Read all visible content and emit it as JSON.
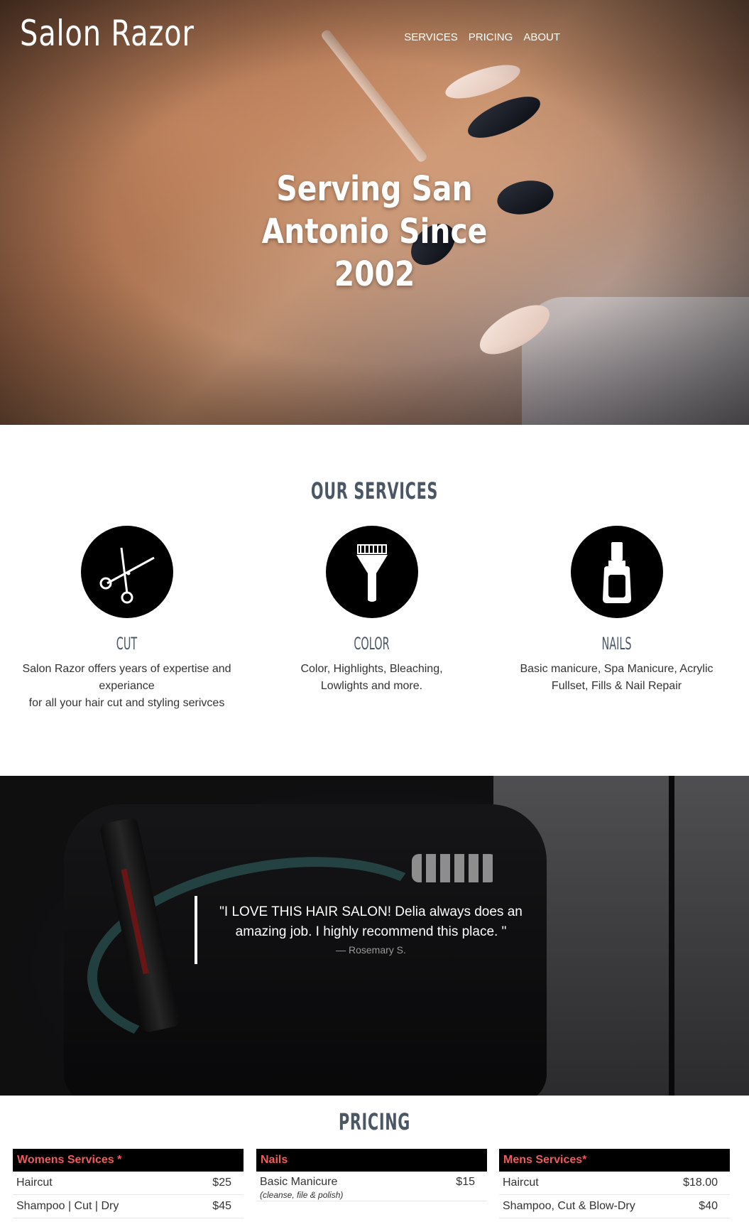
{
  "header": {
    "logo": "Salon Razor",
    "nav": [
      "SERVICES",
      "PRICING",
      "ABOUT"
    ],
    "hero_title": "Serving San Antonio Since 2002"
  },
  "services": {
    "title": "Our Services",
    "items": [
      {
        "title": "Cut",
        "icon": "scissors-icon",
        "text": "Salon Razor offers years of expertise and experiance\nfor all your hair cut and styling serivces"
      },
      {
        "title": "Color",
        "icon": "dye-brush-icon",
        "text": "Color, Highlights, Bleaching,\nLowlights and more."
      },
      {
        "title": "Nails",
        "icon": "nail-polish-icon",
        "text": "Basic manicure, Spa Manicure, Acrylic\nFullset, Fills & Nail Repair"
      }
    ]
  },
  "testimonial": {
    "quote": "\"I LOVE THIS HAIR SALON! Delia always does an amazing job. I highly recommend this place. \"",
    "author": "— Rosemary S."
  },
  "pricing": {
    "title": "Pricing",
    "tables": [
      {
        "heading": "Womens Services *",
        "rows": [
          {
            "name": "Haircut",
            "price": "$25"
          },
          {
            "name": "Shampoo | Cut | Dry",
            "price": "$45"
          }
        ]
      },
      {
        "heading": "Nails",
        "rows": [
          {
            "name": "Basic Manicure",
            "note": "(cleanse, file & polish)",
            "price": "$15"
          }
        ]
      },
      {
        "heading": "Mens Services*",
        "rows": [
          {
            "name": "Haircut",
            "price": "$18.00"
          },
          {
            "name": "Shampoo, Cut & Blow-Dry",
            "price": "$40"
          }
        ]
      }
    ]
  },
  "colors": {
    "accent": "#ee5c5c",
    "heading": "#4c5766",
    "table_head_bg": "#000000"
  }
}
